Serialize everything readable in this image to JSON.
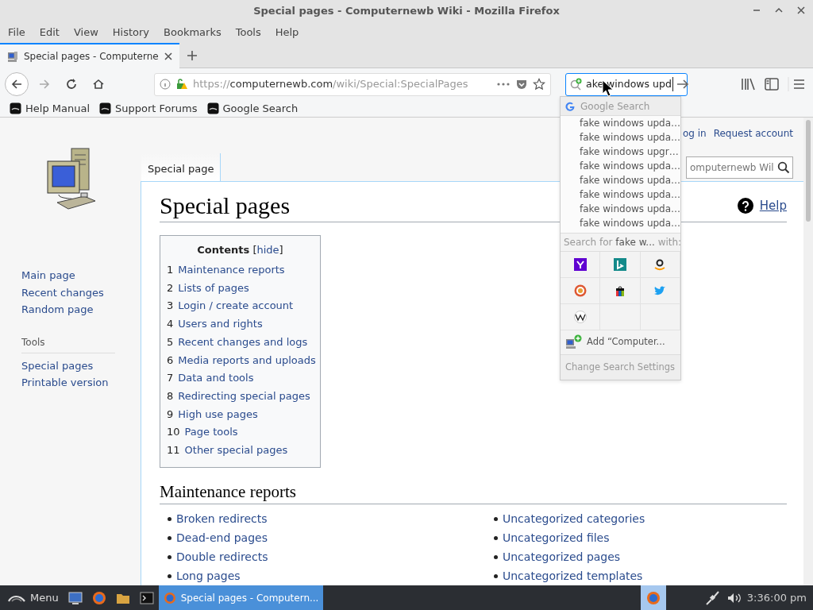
{
  "window": {
    "title": "Special pages - Computernewb Wiki - Mozilla Firefox"
  },
  "menu": [
    "File",
    "Edit",
    "View",
    "History",
    "Bookmarks",
    "Tools",
    "Help"
  ],
  "tabs": [
    {
      "label": "Special pages - Computerne",
      "selected": true
    }
  ],
  "address_bar": {
    "scheme": "https://",
    "domain": "computernewb.com",
    "path": "/wiki/Special:SpecialPages"
  },
  "search_bar": {
    "value": "ake windows upd"
  },
  "bookmarks": [
    "Help Manual",
    "Support Forums",
    "Google Search"
  ],
  "search_popup": {
    "engine": "Google Search",
    "suggestions": [
      "fake windows upda…",
      "fake windows upda…",
      "fake windows upgr…",
      "fake windows upda…",
      "fake windows upda…",
      "fake windows upda…",
      "fake windows upda…",
      "fake windows upda…"
    ],
    "search_for": {
      "prefix": "Search for ",
      "term": "fake w...",
      "suffix": " with:"
    },
    "engines": [
      {
        "kind": "yahoo"
      },
      {
        "kind": "bing"
      },
      {
        "kind": "amazon"
      },
      {
        "kind": "duckduckgo"
      },
      {
        "kind": "ebay"
      },
      {
        "kind": "twitter"
      },
      {
        "kind": "wikipedia"
      }
    ],
    "add_engine": "Add “Computer...",
    "settings": "Change Search Settings"
  },
  "wiki": {
    "personal": [
      "og in",
      "Request account"
    ],
    "search_placeholder": "omputernewb Wil",
    "nav": [
      "Main page",
      "Recent changes",
      "Random page"
    ],
    "tools_heading": "Tools",
    "tools": [
      "Special pages",
      "Printable version"
    ],
    "page_tab": "Special page",
    "heading": "Special pages",
    "help": "Help",
    "toc": {
      "title": "Contents",
      "bracket_open": "[",
      "toggle": "hide",
      "bracket_close": "]",
      "items": [
        {
          "number": "1",
          "label": "Maintenance reports"
        },
        {
          "number": "2",
          "label": "Lists of pages"
        },
        {
          "number": "3",
          "label": "Login / create account"
        },
        {
          "number": "4",
          "label": "Users and rights"
        },
        {
          "number": "5",
          "label": "Recent changes and logs"
        },
        {
          "number": "6",
          "label": "Media reports and uploads"
        },
        {
          "number": "7",
          "label": "Data and tools"
        },
        {
          "number": "8",
          "label": "Redirecting special pages"
        },
        {
          "number": "9",
          "label": "High use pages"
        },
        {
          "number": "10",
          "label": "Page tools"
        },
        {
          "number": "11",
          "label": "Other special pages"
        }
      ]
    },
    "section": {
      "title": "Maintenance reports",
      "left": [
        "Broken redirects",
        "Dead-end pages",
        "Double redirects",
        "Long pages"
      ],
      "right": [
        "Uncategorized categories",
        "Uncategorized files",
        "Uncategorized pages",
        "Uncategorized templates"
      ]
    }
  },
  "taskbar": {
    "menu": "Menu",
    "tasks": [
      {
        "label": "Special pages - Computern...",
        "selected": true
      }
    ],
    "clock": "3:36:00 pm"
  }
}
